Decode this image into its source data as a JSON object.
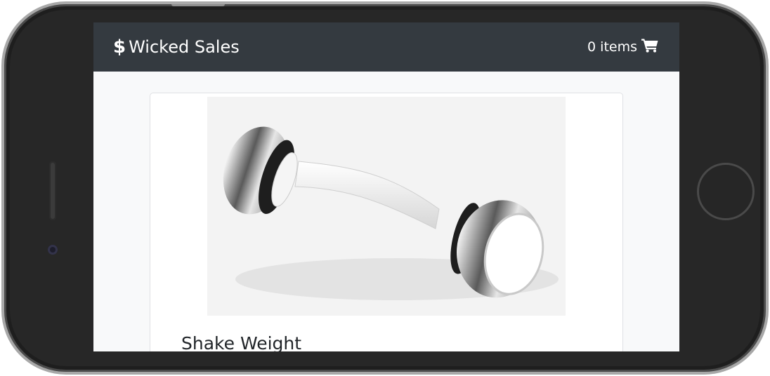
{
  "navbar": {
    "brand_icon": "$",
    "brand_name": "Wicked Sales",
    "cart_label": "0 items",
    "cart_icon": "shopping-cart-icon"
  },
  "product": {
    "name": "Shake Weight",
    "image_subject": "shake-weight-dumbbell"
  },
  "colors": {
    "navbar_bg": "#343a40",
    "page_bg": "#f8f9fa",
    "device_body": "#272727"
  }
}
